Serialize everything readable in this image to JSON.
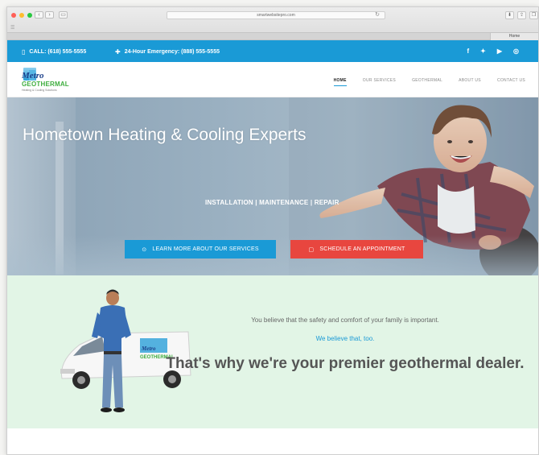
{
  "browser": {
    "url": "smartwebsitepro.com",
    "tab_name": "Home"
  },
  "topbar": {
    "call": "CALL: (618) 555-5555",
    "emergency": "24-Hour Emergency: (888) 555-5555",
    "social": [
      "f",
      "🐦",
      "▶",
      "◎"
    ]
  },
  "logo": {
    "name_top": "Metro",
    "name_bottom": "GEOTHERMAL",
    "tagline": "Heating & Cooling Solutions"
  },
  "nav": {
    "items": [
      "HOME",
      "OUR SERVICES",
      "GEOTHERMAL",
      "ABOUT US",
      "CONTACT US"
    ]
  },
  "hero": {
    "title": "Hometown Heating & Cooling Experts",
    "subtitle": "INSTALLATION | MAINTENANCE | REPAIR",
    "btn_services": "LEARN MORE ABOUT OUR SERVICES",
    "btn_appointment": "SCHEDULE AN APPOINTMENT"
  },
  "band": {
    "line1": "You believe that the safety and comfort of your family is important.",
    "line2": "We believe that, too.",
    "headline": "That's why we're your premier geothermal dealer.",
    "van_name_top": "Metro",
    "van_name_bottom": "GEOTHERMAL"
  },
  "colors": {
    "brand_blue": "#1a9ad6",
    "cta_red": "#e8463f",
    "band_green": "#e2f5e6"
  }
}
